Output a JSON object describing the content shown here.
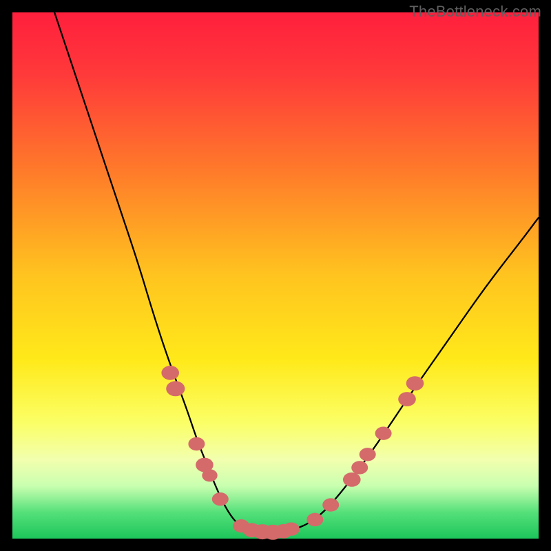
{
  "watermark": "TheBottleneck.com",
  "colors": {
    "frame": "#000000",
    "gradient_stops": [
      {
        "pct": 0,
        "color": "#ff1f3d"
      },
      {
        "pct": 12,
        "color": "#ff3a3a"
      },
      {
        "pct": 30,
        "color": "#ff7a2a"
      },
      {
        "pct": 50,
        "color": "#ffc41f"
      },
      {
        "pct": 66,
        "color": "#ffe91a"
      },
      {
        "pct": 78,
        "color": "#fbff66"
      },
      {
        "pct": 85,
        "color": "#f2ffae"
      },
      {
        "pct": 90,
        "color": "#c9ffb0"
      },
      {
        "pct": 95,
        "color": "#55e07a"
      },
      {
        "pct": 100,
        "color": "#1dc65b"
      }
    ],
    "curve": "#000000",
    "marker": "#d46a6a"
  },
  "chart_data": {
    "type": "line",
    "title": "",
    "xlabel": "",
    "ylabel": "",
    "xlim": [
      0,
      100
    ],
    "ylim": [
      0,
      100
    ],
    "grid": false,
    "legend": false,
    "series": [
      {
        "name": "bottleneck-curve",
        "x": [
          8,
          12,
          16,
          20,
          24,
          27,
          30,
          33,
          35,
          37,
          39,
          41,
          43,
          46,
          49,
          52,
          55,
          58,
          61,
          65,
          70,
          76,
          83,
          90,
          97,
          100
        ],
        "y": [
          100,
          88,
          76,
          64,
          52,
          42,
          33,
          25,
          19,
          14,
          9,
          5,
          2.5,
          1.5,
          1.2,
          1.4,
          2.2,
          4,
          7,
          12,
          19,
          28,
          38,
          48,
          57,
          61
        ]
      }
    ],
    "markers": [
      {
        "x": 30.0,
        "y": 31.5,
        "r": 1.6
      },
      {
        "x": 31.0,
        "y": 28.5,
        "r": 1.7
      },
      {
        "x": 35.0,
        "y": 18.0,
        "r": 1.5
      },
      {
        "x": 36.5,
        "y": 14.0,
        "r": 1.6
      },
      {
        "x": 37.5,
        "y": 12.0,
        "r": 1.4
      },
      {
        "x": 39.5,
        "y": 7.5,
        "r": 1.5
      },
      {
        "x": 43.5,
        "y": 2.4,
        "r": 1.5
      },
      {
        "x": 45.5,
        "y": 1.6,
        "r": 1.6
      },
      {
        "x": 47.5,
        "y": 1.3,
        "r": 1.7
      },
      {
        "x": 49.5,
        "y": 1.2,
        "r": 1.7
      },
      {
        "x": 51.5,
        "y": 1.4,
        "r": 1.6
      },
      {
        "x": 53.0,
        "y": 1.8,
        "r": 1.5
      },
      {
        "x": 57.5,
        "y": 3.6,
        "r": 1.5
      },
      {
        "x": 60.5,
        "y": 6.4,
        "r": 1.5
      },
      {
        "x": 64.5,
        "y": 11.2,
        "r": 1.6
      },
      {
        "x": 66.0,
        "y": 13.5,
        "r": 1.5
      },
      {
        "x": 67.5,
        "y": 16.0,
        "r": 1.5
      },
      {
        "x": 70.5,
        "y": 20.0,
        "r": 1.5
      },
      {
        "x": 75.0,
        "y": 26.5,
        "r": 1.6
      },
      {
        "x": 76.5,
        "y": 29.5,
        "r": 1.6
      }
    ]
  }
}
